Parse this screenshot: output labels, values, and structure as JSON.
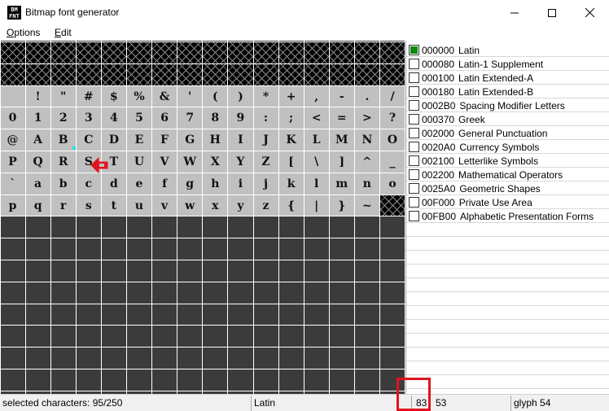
{
  "window": {
    "title": "Bitmap font generator",
    "icon_text": "BM\nFONT"
  },
  "menu": {
    "options_first": "O",
    "options_rest": "ptions",
    "edit_first": "E",
    "edit_rest": "dit"
  },
  "glyph_grid": {
    "rows": [
      [
        "",
        "",
        "",
        "",
        "",
        "",
        "",
        "",
        "",
        "",
        "",
        "",
        "",
        "",
        "",
        ""
      ],
      [
        "",
        "",
        "",
        "",
        "",
        "",
        "",
        "",
        "",
        "",
        "",
        "",
        "",
        "",
        "",
        ""
      ],
      [
        "",
        "!",
        "\"",
        "#",
        "$",
        "%",
        "&",
        "'",
        "(",
        ")",
        "*",
        "+",
        ",",
        "-",
        ".",
        "/"
      ],
      [
        "0",
        "1",
        "2",
        "3",
        "4",
        "5",
        "6",
        "7",
        "8",
        "9",
        ":",
        ";",
        "<",
        "=",
        ">",
        "?"
      ],
      [
        "@",
        "A",
        "B",
        "C",
        "D",
        "E",
        "F",
        "G",
        "H",
        "I",
        "J",
        "K",
        "L",
        "M",
        "N",
        "O"
      ],
      [
        "P",
        "Q",
        "R",
        "S",
        "T",
        "U",
        "V",
        "W",
        "X",
        "Y",
        "Z",
        "[",
        "\\",
        "]",
        "^",
        "_"
      ],
      [
        "`",
        "a",
        "b",
        "c",
        "d",
        "e",
        "f",
        "g",
        "h",
        "i",
        "j",
        "k",
        "l",
        "m",
        "n",
        "o"
      ],
      [
        "p",
        "q",
        "r",
        "s",
        "t",
        "u",
        "v",
        "w",
        "x",
        "y",
        "z",
        "{",
        "|",
        "}",
        "~",
        ""
      ]
    ],
    "hatched_cells": [
      "0-*",
      "1-*",
      "7-15"
    ]
  },
  "ranges": [
    {
      "code": "000000",
      "name": "Latin",
      "checked": true
    },
    {
      "code": "000080",
      "name": "Latin-1 Supplement",
      "checked": false
    },
    {
      "code": "000100",
      "name": "Latin Extended-A",
      "checked": false
    },
    {
      "code": "000180",
      "name": "Latin Extended-B",
      "checked": false
    },
    {
      "code": "0002B0",
      "name": "Spacing Modifier Letters",
      "checked": false
    },
    {
      "code": "000370",
      "name": "Greek",
      "checked": false
    },
    {
      "code": "002000",
      "name": "General Punctuation",
      "checked": false
    },
    {
      "code": "0020A0",
      "name": "Currency Symbols",
      "checked": false
    },
    {
      "code": "002100",
      "name": "Letterlike Symbols",
      "checked": false
    },
    {
      "code": "002200",
      "name": "Mathematical Operators",
      "checked": false
    },
    {
      "code": "0025A0",
      "name": "Geometric Shapes",
      "checked": false
    },
    {
      "code": "00F000",
      "name": "Private Use Area",
      "checked": false
    },
    {
      "code": "00FB00",
      "name": "Alphabetic Presentation Forms",
      "checked": false
    }
  ],
  "status": {
    "selected": "selected characters: 95/250",
    "range": "Latin",
    "hex": "83",
    "dec": "53",
    "glyph": "glyph 54"
  },
  "colors": {
    "accent_highlight": "#e0141e",
    "checked_box": "#0b8a0b"
  }
}
